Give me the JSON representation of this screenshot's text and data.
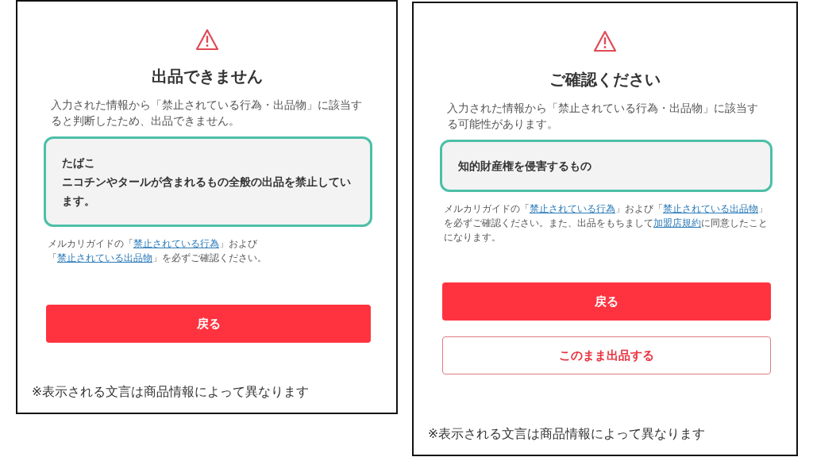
{
  "panels": [
    {
      "title": "出品できません",
      "description": "入力された情報から「禁止されている行為・出品物」に該当すると判断したため、出品できません。",
      "notice": [
        "たばこ",
        "ニコチンやタールが含まれるもの全般の出品を禁止しています。"
      ],
      "guide": [
        {
          "kind": "text",
          "text": "メルカリガイドの「"
        },
        {
          "kind": "link",
          "text": "禁止されている行為"
        },
        {
          "kind": "text",
          "text": "」および「"
        },
        {
          "kind": "link",
          "text": "禁止されている出品物"
        },
        {
          "kind": "text",
          "text": "」を必ずご確認ください。"
        }
      ],
      "buttons": [
        {
          "label": "戻る",
          "kind": "primary"
        }
      ],
      "footnote": "※表示される文言は商品情報によって異なります"
    },
    {
      "title": "ご確認ください",
      "description": "入力された情報から「禁止されている行為・出品物」に該当する可能性があります。",
      "notice": [
        "知的財産権を侵害するもの"
      ],
      "guide": [
        {
          "kind": "text",
          "text": "メルカリガイドの「"
        },
        {
          "kind": "link",
          "text": "禁止されている行為"
        },
        {
          "kind": "text",
          "text": "」および「"
        },
        {
          "kind": "link",
          "text": "禁止されている出品物"
        },
        {
          "kind": "text",
          "text": "」を必ずご確認ください。また、出品をもちまして"
        },
        {
          "kind": "link",
          "text": "加盟店規約"
        },
        {
          "kind": "text",
          "text": "に同意したことになります。"
        }
      ],
      "buttons": [
        {
          "label": "戻る",
          "kind": "primary"
        },
        {
          "label": "このまま出品する",
          "kind": "outline"
        }
      ],
      "footnote": "※表示される文言は商品情報によって異なります"
    }
  ]
}
